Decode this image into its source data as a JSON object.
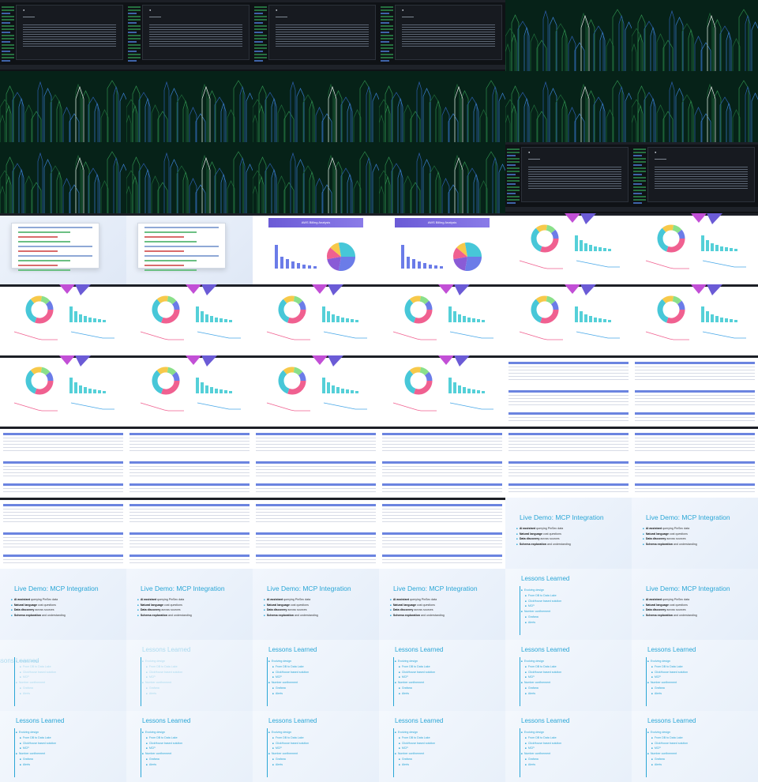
{
  "dashboard": {
    "header": "AWS Billing Analysis"
  },
  "mcp_slide": {
    "title": "Live Demo: MCP Integration",
    "bullets": [
      {
        "strong": "AI assistant",
        "rest": " querying PinSec data"
      },
      {
        "strong": "Natural language",
        "rest": " cost questions"
      },
      {
        "strong": "Data discovery",
        "rest": " across sources"
      },
      {
        "strong": "Schema exploration",
        "rest": " and understanding"
      }
    ]
  },
  "lessons_slide": {
    "title": "Lessons Learned",
    "items": [
      {
        "text": "Evolving design",
        "sub": false
      },
      {
        "text": "From DB to Data Lake",
        "sub": true
      },
      {
        "text": "ClickHouse based solution",
        "sub": true
      },
      {
        "text": "MCP",
        "sub": true
      },
      {
        "text": "Number confinement",
        "sub": false
      },
      {
        "text": "Grafana",
        "sub": true
      },
      {
        "text": "Alerts",
        "sub": true
      }
    ]
  },
  "colors": {
    "accent": "#2aa6d6",
    "terminal_bg": "#0f1216",
    "city_bg": "#062218",
    "dash_header": "#6b5bd6",
    "table_header": "#6b84e0"
  },
  "grid": [
    [
      "terminal",
      "terminal",
      "terminal",
      "terminal",
      "city",
      "city"
    ],
    [
      "city",
      "city",
      "city",
      "city",
      "city",
      "city"
    ],
    [
      "city",
      "city",
      "city",
      "city",
      "terminal",
      "terminal"
    ],
    [
      "code",
      "code",
      "dash",
      "dash",
      "charts",
      "charts"
    ],
    [
      "charts",
      "charts",
      "charts",
      "charts",
      "charts",
      "charts"
    ],
    [
      "charts",
      "charts",
      "charts",
      "charts",
      "table",
      "table"
    ],
    [
      "table",
      "table",
      "table",
      "table",
      "table",
      "table"
    ],
    [
      "table",
      "table",
      "table",
      "table",
      "mcp",
      "mcp"
    ],
    [
      "mcp",
      "mcp",
      "mcp",
      "mcp",
      "lessons",
      "mcp"
    ],
    [
      "lessons-fade-left",
      "lessons-fade",
      "lessons",
      "lessons",
      "lessons",
      "lessons"
    ],
    [
      "lessons",
      "lessons",
      "lessons",
      "lessons",
      "lessons",
      "lessons"
    ]
  ]
}
